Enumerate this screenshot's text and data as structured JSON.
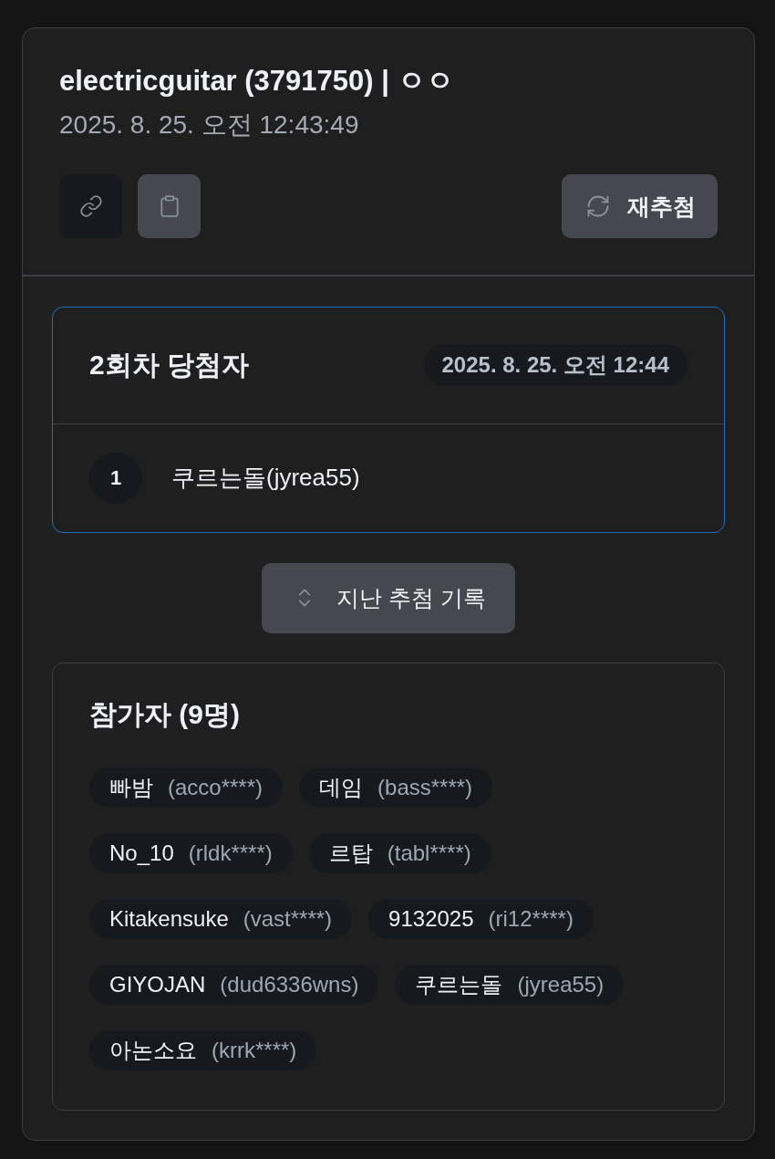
{
  "draw": {
    "title": "electricguitar (3791750) | ㅇㅇ",
    "timestamp": "2025. 8. 25. 오전 12:43:49",
    "redraw_button": {
      "label": "재추첨"
    }
  },
  "winners_panel": {
    "title": "2회차 당첨자",
    "time": "2025. 8. 25. 오전 12:44",
    "winners": [
      {
        "rank": "1",
        "name": "쿠르는돌(jyrea55)"
      }
    ]
  },
  "history_button": {
    "label": "지난 추첨 기록"
  },
  "participants": {
    "title": "참가자 (9명)",
    "items": [
      {
        "nickname": "빠밤",
        "id": "(acco****)"
      },
      {
        "nickname": "데임",
        "id": "(bass****)"
      },
      {
        "nickname": "No_10",
        "id": "(rldk****)"
      },
      {
        "nickname": "르탑",
        "id": "(tabl****)"
      },
      {
        "nickname": "Kitakensuke",
        "id": "(vast****)"
      },
      {
        "nickname": "9132025",
        "id": "(ri12****)"
      },
      {
        "nickname": "GIYOJAN",
        "id": "(dud6336wns)"
      },
      {
        "nickname": "쿠르는돌",
        "id": "(jyrea55)"
      },
      {
        "nickname": "아논소요",
        "id": "(krrk****)"
      }
    ]
  }
}
